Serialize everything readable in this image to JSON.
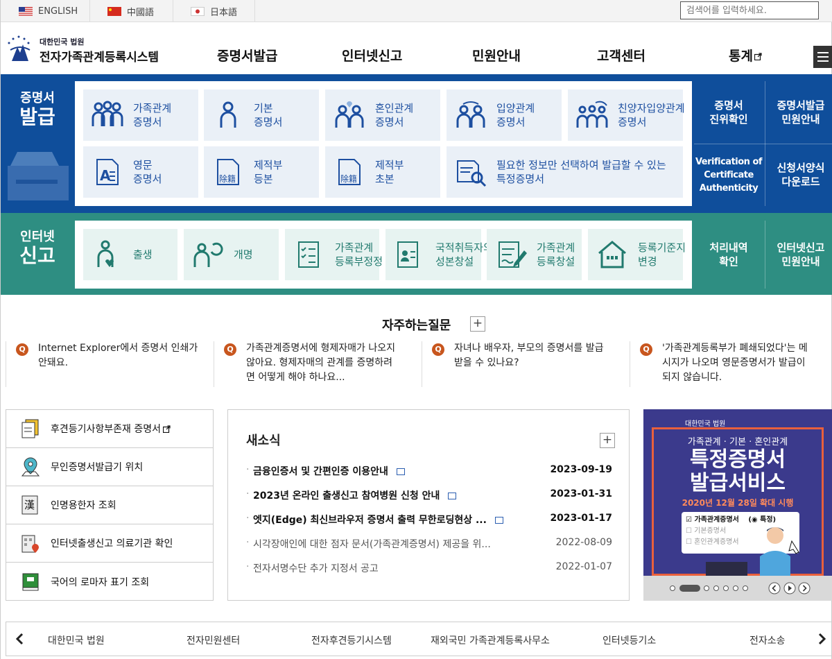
{
  "top": {
    "languages": [
      {
        "label": "ENGLISH",
        "icon": "us-flag-icon"
      },
      {
        "label": "中國語",
        "icon": "cn-flag-icon"
      },
      {
        "label": "日本語",
        "icon": "jp-flag-icon"
      }
    ],
    "search_placeholder": "검색어를 입력하세요."
  },
  "header": {
    "logo_sub": "대한민국 법원",
    "logo_main": "전자가족관계등록시스템",
    "nav": [
      "증명서발급",
      "인터넷신고",
      "민원안내",
      "고객센터",
      "통계"
    ]
  },
  "issuance": {
    "title_small": "증명서",
    "title_big": "발급",
    "cards": [
      {
        "label": "가족관계\n증명서",
        "icon": "family-icon"
      },
      {
        "label": "기본\n증명서",
        "icon": "person-icon"
      },
      {
        "label": "혼인관계\n증명서",
        "icon": "couple-heart-icon"
      },
      {
        "label": "입양관계\n증명서",
        "icon": "adoption-icon"
      },
      {
        "label": "친양자입양관계\n증명서",
        "icon": "full-adoption-icon"
      },
      {
        "label": "영문\n증명서",
        "icon": "english-doc-icon"
      },
      {
        "label": "제적부\n등본",
        "icon": "register-copy-icon"
      },
      {
        "label": "제적부\n초본",
        "icon": "register-abstract-icon"
      },
      {
        "label": "필요한 정보만 선택하여 발급할 수 있는\n특정증명서",
        "icon": "search-doc-icon"
      }
    ],
    "side": [
      "증명서\n진위확인",
      "증명서발급\n민원안내",
      "Verification of\nCertificate\nAuthenticity",
      "신청서양식\n다운로드"
    ]
  },
  "report": {
    "title_small": "인터넷",
    "title_big": "신고",
    "cards": [
      {
        "label": "출생",
        "icon": "birth-icon"
      },
      {
        "label": "개명",
        "icon": "rename-icon"
      },
      {
        "label": "가족관계\n등록부정정",
        "icon": "correction-icon"
      },
      {
        "label": "국적취득자의\n성본창설",
        "icon": "nationality-icon"
      },
      {
        "label": "가족관계\n등록창설",
        "icon": "registration-create-icon"
      },
      {
        "label": "등록기준지\n변경",
        "icon": "house-icon"
      }
    ],
    "side": [
      "처리내역\n확인",
      "인터넷신고\n민원안내"
    ]
  },
  "faq": {
    "title": "자주하는질문",
    "items": [
      "Internet Explorer에서 증명서 인쇄가\n안돼요.",
      "가족관계증명서에 형제자매가 나오지\n않아요. 형제자매의 관계를 증명하려\n면 어떻게 해야 하나요...",
      "자녀나 배우자, 부모의 증명서를 발급\n받을 수 있나요?",
      "'가족관계등록부가 폐쇄되었다'는 메\n시지가 나오며 영문증명서가 발급이\n되지 않습니다."
    ]
  },
  "quick": [
    {
      "label": "후견등기사항부존재 증명서",
      "icon": "guardian-doc-icon"
    },
    {
      "label": "무인증명서발급기 위치",
      "icon": "location-pin-icon"
    },
    {
      "label": "인명용한자 조회",
      "icon": "hanja-book-icon"
    },
    {
      "label": "인터넷출생신고 의료기관 확인",
      "icon": "hospital-icon"
    },
    {
      "label": "국어의 로마자 표기 조회",
      "icon": "green-book-icon"
    }
  ],
  "news": {
    "title": "새소식",
    "items": [
      {
        "text": "금융인증서 및 간편인증 이용안내",
        "date": "2023-09-19"
      },
      {
        "text": "2023년 온라인 출생신고 참여병원 신청 안내",
        "date": "2023-01-31"
      },
      {
        "text": "엣지(Edge) 최신브라우저 증명서 출력 무한로딩현상 ...",
        "date": "2023-01-17"
      },
      {
        "text": "시각장애인에 대한 점자 문서(가족관계증명서) 제공을 위...",
        "date": "2022-08-09"
      },
      {
        "text": "전자서명수단 추가 지정서 공고",
        "date": "2022-01-07"
      }
    ]
  },
  "banner": {
    "court": "대한민국 법원",
    "line1": "가족관계 · 기본 · 혼인관계",
    "line2": "특정증명서",
    "line3": "발급서비스",
    "line4": "2020년 12월 28일 확대 시행",
    "options": [
      "가족관계증명서",
      "기본증명서",
      "혼인관계증명서"
    ],
    "tag": "특정"
  },
  "footer": [
    "대한민국 법원",
    "전자민원센터",
    "전자후견등기시스템",
    "재외국민 가족관계등록사무소",
    "인터넷등기소",
    "전자소송"
  ]
}
